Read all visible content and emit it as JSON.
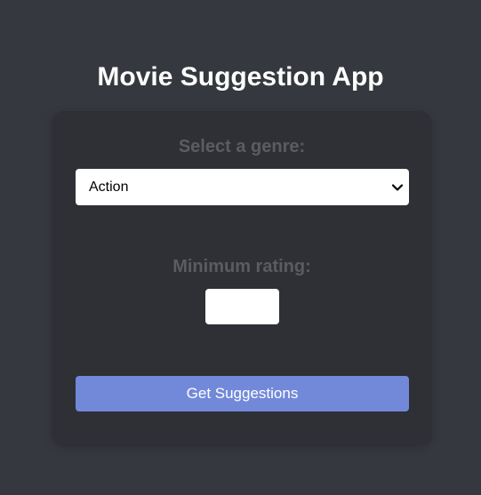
{
  "app": {
    "title": "Movie Suggestion App"
  },
  "form": {
    "genre_label": "Select a genre:",
    "genre_value": "Action",
    "rating_label": "Minimum rating:",
    "rating_value": "",
    "submit_label": "Get Suggestions"
  },
  "colors": {
    "background": "#36383f",
    "card": "#2f3035",
    "label": "#5b5c61",
    "button": "#7289da"
  },
  "icons": {
    "select_arrow": "chevron-down-icon"
  }
}
